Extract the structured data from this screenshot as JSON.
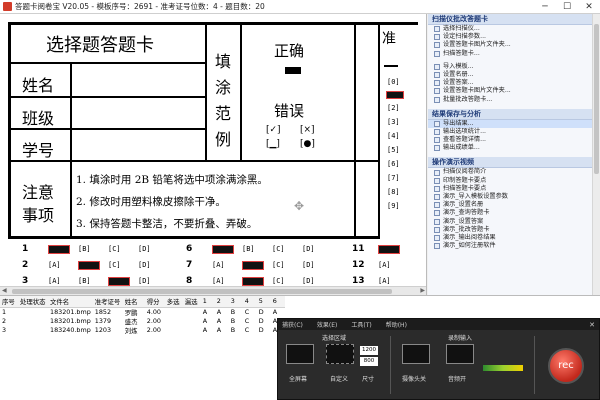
{
  "window": {
    "title": "答题卡阅卷宝 V20.05 - 模板序号：2691 - 准考证号位数：4 - 题目数：20"
  },
  "sheet": {
    "header_title": "选择题答题卡",
    "fill_label": [
      "填",
      "涂",
      "范",
      "例"
    ],
    "correct_label": "正确",
    "wrong_label": "错误",
    "wrong_examples": [
      "[✓]",
      "[×]",
      "[▁]",
      "[●]"
    ],
    "fields": [
      "姓名",
      "班级",
      "学号"
    ],
    "notes_label": [
      "注意",
      "事项"
    ],
    "notes": [
      "1. 填涂时用 2B 铅笔将选中项涂满涂黑。",
      "2. 修改时用塑料橡皮擦除干净。",
      "3. 保持答题卡整洁，不要折叠、弄破。"
    ],
    "id_header": "准",
    "id_digits": [
      "[0]",
      "[1]",
      "[2]",
      "[3]",
      "[4]",
      "[5]",
      "[6]",
      "[7]",
      "[8]",
      "[9]"
    ],
    "questions": [
      {
        "n": "1",
        "opts": [
          "[A]",
          "[B]",
          "[C]",
          "[D]"
        ],
        "filled": 0
      },
      {
        "n": "2",
        "opts": [
          "[A]",
          "[B]",
          "[C]",
          "[D]"
        ],
        "filled": 1
      },
      {
        "n": "3",
        "opts": [
          "[A]",
          "[B]",
          "[C]",
          "[D]"
        ],
        "filled": 2
      },
      {
        "n": "6",
        "opts": [
          "[A]",
          "[B]",
          "[C]",
          "[D]"
        ],
        "filled": 0
      },
      {
        "n": "7",
        "opts": [
          "[A]",
          "[B]",
          "[C]",
          "[D]"
        ],
        "filled": 1
      },
      {
        "n": "8",
        "opts": [
          "[A]",
          "[B]",
          "[C]",
          "[D]"
        ],
        "filled": 1
      },
      {
        "n": "11",
        "opts": [
          "[A]"
        ],
        "filled": 0
      },
      {
        "n": "12",
        "opts": [
          "[A]"
        ],
        "filled": -1
      },
      {
        "n": "13",
        "opts": [
          "[A]"
        ],
        "filled": -1
      }
    ]
  },
  "panel": {
    "sections": [
      {
        "header": "扫描仪批改答题卡",
        "items": [
          "选择扫描仪...",
          "设定扫描参数...",
          "设置答题卡图片文件夹...",
          "扫描答题卡..."
        ]
      },
      {
        "header": "",
        "items": [
          "导入模板...",
          "设置名册...",
          "设置答案...",
          "设置答题卡图片文件夹...",
          "批量批改答题卡..."
        ]
      },
      {
        "header": "结果保存与分析",
        "items": [
          "导出结果...",
          "输出选项统计...",
          "查看答题详情...",
          "输出成绩单..."
        ]
      },
      {
        "header": "操作演示视频",
        "items": [
          "扫描仪阅卷简介",
          "印制答题卡要点",
          "扫描答题卡要点",
          "演示_导入模板设置参数",
          "演示_设置名册",
          "演示_查询答题卡",
          "演示_设置答案",
          "演示_批改答题卡",
          "演示_输出阅卷结果",
          "演示_如何注册软件"
        ]
      }
    ]
  },
  "table": {
    "columns": [
      "序号",
      "处理状态",
      "文件名",
      "准考证号",
      "姓名",
      "得分",
      "多选",
      "漏选",
      "1",
      "2",
      "3",
      "4",
      "5",
      "6"
    ],
    "rows": [
      [
        "1",
        "",
        "183201.bmp",
        "1852",
        "罗鹏",
        "4.00",
        "",
        "",
        "A",
        "A",
        "B",
        "C",
        "D",
        "A"
      ],
      [
        "2",
        "",
        "183201.bmp",
        "1379",
        "盛杰",
        "2.00",
        "",
        "",
        "A",
        "A",
        "B",
        "C",
        "D",
        "A"
      ],
      [
        "3",
        "",
        "183240.bmp",
        "1203",
        "刘炼",
        "2.00",
        "",
        "",
        "A",
        "A",
        "B",
        "C",
        "D",
        "A"
      ]
    ]
  },
  "recorder": {
    "menu": [
      "捕获(C)",
      "效果(E)",
      "工具(T)",
      "帮助(H)"
    ],
    "area_label": "选择区域",
    "fullscreen_label": "全屏幕",
    "custom_label": "自定义",
    "size_label": "尺寸",
    "width": "1200",
    "height": "800",
    "input_label": "录制输入",
    "camera_label": "摄像头关",
    "audio_label": "音频开",
    "rec_label": "rec"
  },
  "colors": {
    "accent": "#1f3b78",
    "filled_border": "#e04040",
    "rec": "#c2281c"
  }
}
